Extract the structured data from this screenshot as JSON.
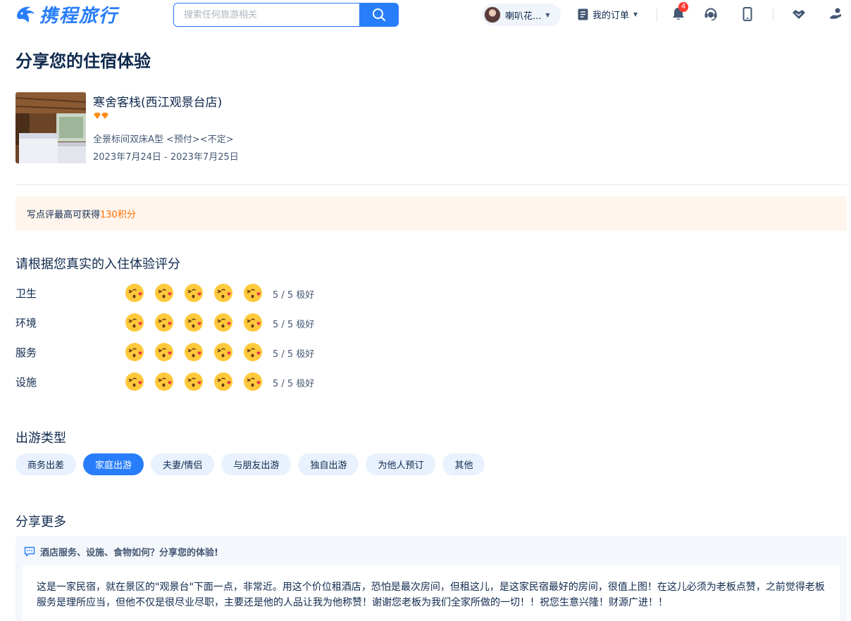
{
  "header": {
    "brand": "携程旅行",
    "search_placeholder": "搜索任何旅游相关",
    "user_name": "喇叭花...",
    "orders_label": "我的订单",
    "notification_count": "4",
    "icons": [
      "search-icon",
      "bell-icon",
      "customer-service-icon",
      "mobile-icon",
      "handshake-icon",
      "login-icon"
    ]
  },
  "page": {
    "title": "分享您的住宿体验"
  },
  "hotel": {
    "name": "寒舍客栈(西江观景台店)",
    "diamond_rating": 2,
    "room_type": "全景标间双床A型 <预付><不定>",
    "dates": "2023年7月24日 - 2023年7月25日"
  },
  "points": {
    "prefix": "写点评最高可获得",
    "highlight": "130积分"
  },
  "rating": {
    "title": "请根据您真实的入住体验评分",
    "rows": [
      {
        "label": "卫生",
        "score": "5 / 5",
        "desc": "极好",
        "value": 5,
        "max": 5
      },
      {
        "label": "环境",
        "score": "5 / 5",
        "desc": "极好",
        "value": 5,
        "max": 5
      },
      {
        "label": "服务",
        "score": "5 / 5",
        "desc": "极好",
        "value": 5,
        "max": 5
      },
      {
        "label": "设施",
        "score": "5 / 5",
        "desc": "极好",
        "value": 5,
        "max": 5
      }
    ]
  },
  "trip_type": {
    "title": "出游类型",
    "options": [
      "商务出差",
      "家庭出游",
      "夫妻/情侣",
      "与朋友出游",
      "独自出游",
      "为他人预订",
      "其他"
    ],
    "selected": "家庭出游"
  },
  "share_more": {
    "title": "分享更多",
    "hint": "酒店服务、设施、食物如何？分享您的体验!",
    "text": "这是一家民宿，就在景区的\"观景台\"下面一点，非常近。用这个价位租酒店，恐怕是最次房间，但租这儿，是这家民宿最好的房间，很值上图！在这儿必须为老板点赞，之前觉得老板服务是理所应当，但他不仅是很尽业尽职，主要还是他的人品让我为他称赞！谢谢您老板为我们全家所做的一切！！祝您生意兴隆！财源广进！！"
  },
  "colors": {
    "accent": "#287dfa",
    "points": "#ff6f00",
    "banner_bg": "#fff5ec",
    "chip_bg": "#e8f1fd",
    "text": "#0f294d",
    "notification": "#ff3b30"
  }
}
